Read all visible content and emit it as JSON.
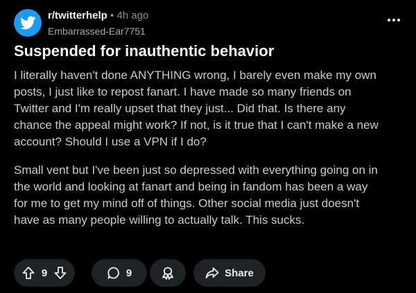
{
  "post": {
    "subreddit": "r/twitterhelp",
    "separator": "•",
    "time": "4h ago",
    "author": "Embarrassed-Ear7751",
    "title": "Suspended for inauthentic behavior",
    "body_paragraph_1_lines": [
      "I literally haven't done ANYTHING wrong, I barely even make my own",
      "posts, I just like to repost fanart. I have made so many friends on",
      "Twitter and I'm really upset that they just... Did that. Is there any",
      "chance the appeal might work? If not, is it true that I can't make a new",
      "account? Should I use a VPN if I do?"
    ],
    "body_paragraph_2_lines": [
      "Small vent but I've been just so depressed with everything going on in",
      "the world and looking at fanart and being in fandom has been a way",
      "for me to get my mind off of things. Other social media just doesn't",
      "have as many people willing to actually talk. This sucks."
    ]
  },
  "actions": {
    "vote_count": "9",
    "comment_count": "9",
    "share_label": "Share"
  },
  "colors": {
    "background": "#000000",
    "avatar": "#1d9bf0",
    "pill": "#202324"
  },
  "icons": {
    "avatar": "twitter-bird-icon",
    "more": "more-horizontal-icon",
    "upvote": "upvote-arrow-icon",
    "downvote": "downvote-arrow-icon",
    "comment": "comment-bubble-icon",
    "award": "award-icon",
    "share": "share-arrow-icon"
  }
}
